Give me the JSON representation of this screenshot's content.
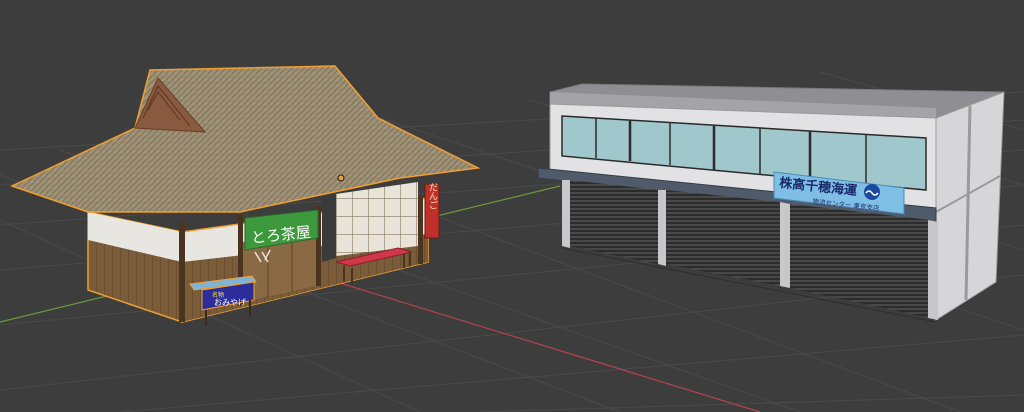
{
  "viewport": {
    "background": "#3d3d3d",
    "grid_color": "#4a4a4a",
    "x_axis_color": "#b3434d",
    "y_axis_color": "#6a9a3b",
    "selection_outline_color": "#f0a030"
  },
  "teahouse": {
    "banner_green_text": "とろ茶屋",
    "red_sign_text": "だんご",
    "blue_sign_small_text": "名物",
    "blue_sign_text": "おみやげ",
    "origin_marker": "origin-dot-icon"
  },
  "warehouse": {
    "sign_main_text": "株高千穂海運",
    "sign_sub_text": "物流センター 東京支店",
    "logo_icon": "wave-logo-icon"
  }
}
